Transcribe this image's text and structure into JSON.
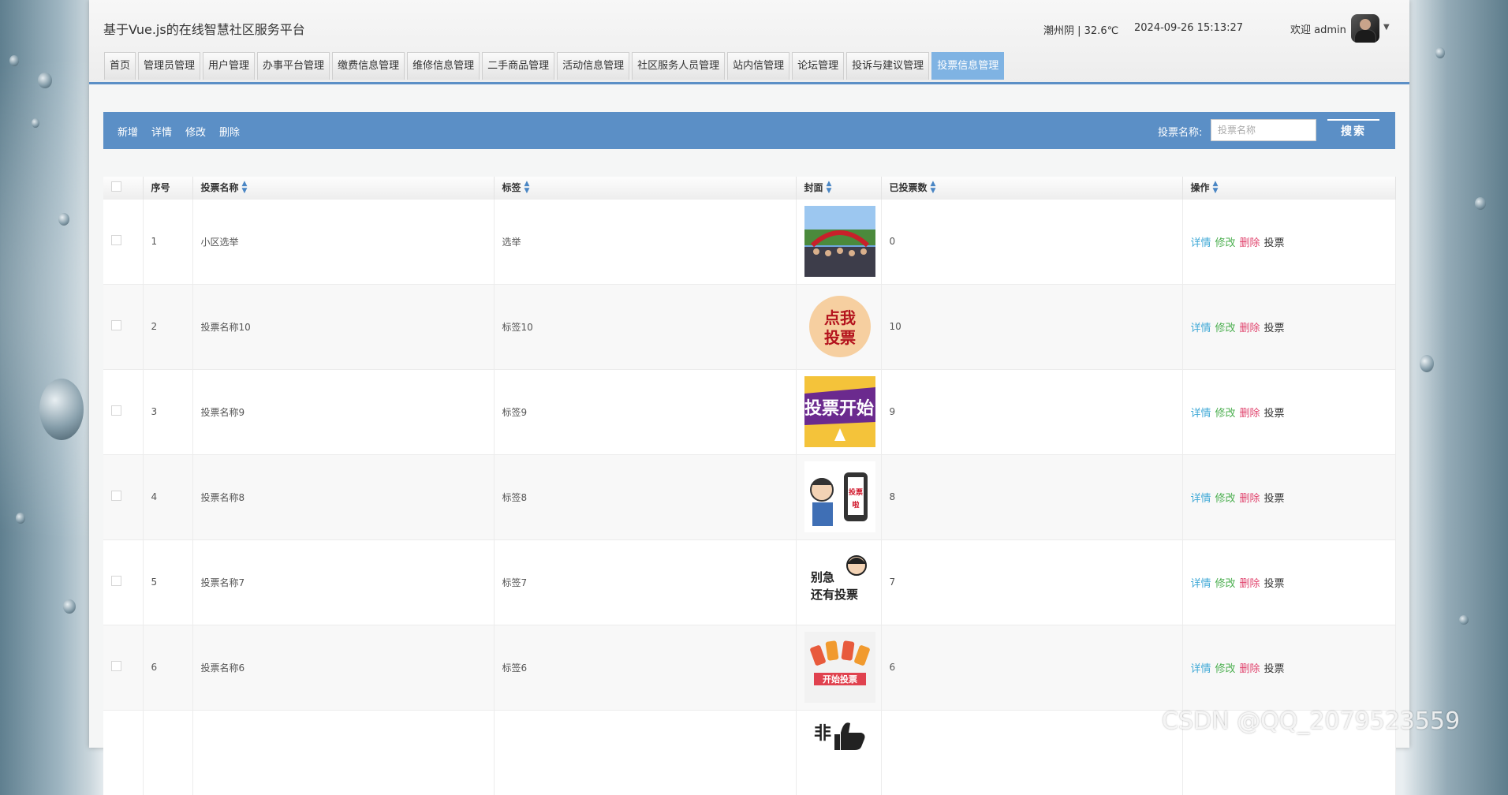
{
  "header": {
    "site_title": "基于Vue.js的在线智慧社区服务平台",
    "weather": "潮州阴 | 32.6℃",
    "datetime": "2024-09-26  15:13:27",
    "welcome": "欢迎 admin"
  },
  "nav": {
    "tabs": [
      {
        "label": "首页",
        "active": false
      },
      {
        "label": "管理员管理",
        "active": false
      },
      {
        "label": "用户管理",
        "active": false
      },
      {
        "label": "办事平台管理",
        "active": false
      },
      {
        "label": "缴费信息管理",
        "active": false
      },
      {
        "label": "维修信息管理",
        "active": false
      },
      {
        "label": "二手商品管理",
        "active": false
      },
      {
        "label": "活动信息管理",
        "active": false
      },
      {
        "label": "社区服务人员管理",
        "active": false
      },
      {
        "label": "站内信管理",
        "active": false
      },
      {
        "label": "论坛管理",
        "active": false
      },
      {
        "label": "投诉与建议管理",
        "active": false
      },
      {
        "label": "投票信息管理",
        "active": true
      }
    ]
  },
  "toolbar": {
    "add": "新增",
    "detail": "详情",
    "edit": "修改",
    "delete": "删除",
    "search_label": "投票名称:",
    "search_placeholder": "投票名称",
    "search_button": "搜索"
  },
  "table": {
    "columns": [
      "序号",
      "投票名称",
      "标签",
      "封面",
      "已投票数",
      "操作"
    ],
    "actions": [
      "详情",
      "修改",
      "删除",
      "投票"
    ],
    "rows": [
      {
        "no": "1",
        "name": "小区选举",
        "tag": "选举",
        "count": "0",
        "cover": "crowd-photo"
      },
      {
        "no": "2",
        "name": "投票名称10",
        "tag": "标签10",
        "count": "10",
        "cover": "click-to-vote-badge",
        "cover_text": "点我投票"
      },
      {
        "no": "3",
        "name": "投票名称9",
        "tag": "标签9",
        "count": "9",
        "cover": "vote-start-banner",
        "cover_text": "投票开始"
      },
      {
        "no": "4",
        "name": "投票名称8",
        "tag": "标签8",
        "count": "8",
        "cover": "cartoon-vote",
        "cover_text": "投票啦"
      },
      {
        "no": "5",
        "name": "投票名称7",
        "tag": "标签7",
        "count": "7",
        "cover": "dont-rush-vote",
        "cover_text": "别急 还有投票"
      },
      {
        "no": "6",
        "name": "投票名称6",
        "tag": "标签6",
        "count": "6",
        "cover": "phones-vote",
        "cover_text": "开始投票"
      },
      {
        "no": "",
        "name": "",
        "tag": "",
        "count": "",
        "cover": "thumbs-up",
        "cover_text": "非"
      }
    ]
  },
  "watermark": "CSDN @QQ_2079523559",
  "colors": {
    "accent": "#5b8fc6",
    "active_tab": "#7fb3e3",
    "detail": "#3ea8d6",
    "edit": "#4caf50",
    "delete": "#e0436d"
  }
}
